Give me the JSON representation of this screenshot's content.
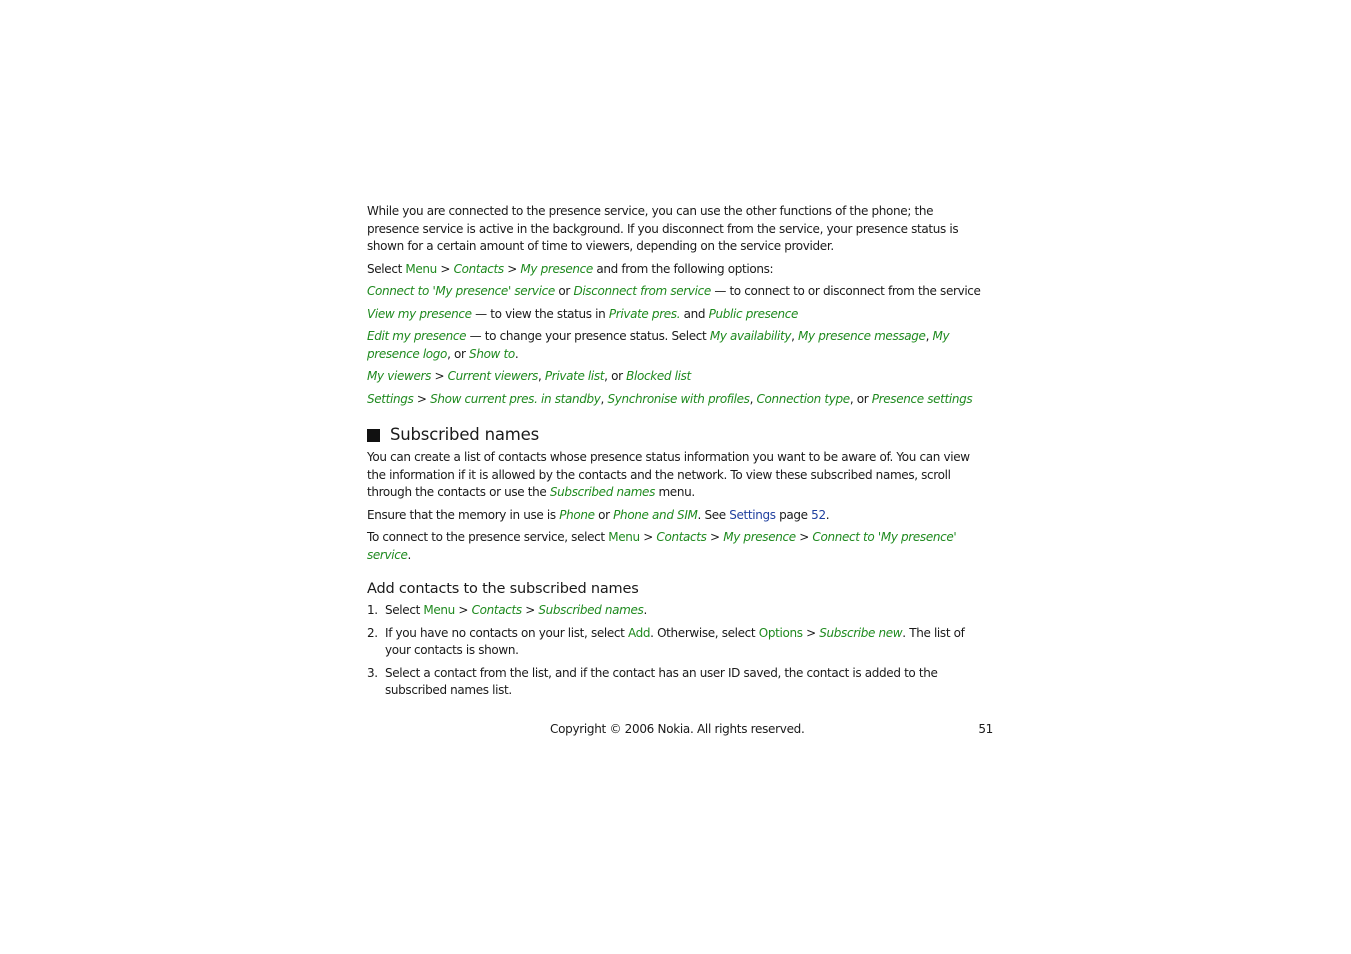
{
  "intro": {
    "p1": "While you are connected to the presence service, you can use the other functions of the phone; the presence service is active in the background. If you disconnect from the service, your presence status is shown for a certain amount of time to viewers, depending on the service provider.",
    "select_prefix": "Select ",
    "menu": "Menu",
    "sep": " > ",
    "contacts": "Contacts",
    "my_presence": "My presence",
    "select_suffix": " and from the following options:"
  },
  "options": {
    "connect": "Connect to 'My presence' service",
    "or": " or ",
    "disconnect": "Disconnect from service",
    "connect_desc": " — to connect to or disconnect from the service",
    "view": "View my presence",
    "view_desc": " — to view the status in ",
    "private_pres": "Private pres.",
    "and": " and ",
    "public_presence": "Public presence",
    "edit": "Edit my presence",
    "edit_desc": " — to change your presence status. Select ",
    "my_availability": "My availability",
    "comma": ", ",
    "my_presence_message": "My presence message",
    "my_presence_logo": "My presence logo",
    "or2": ", or ",
    "show_to": "Show to",
    "period": ".",
    "my_viewers": "My viewers",
    "current_viewers": "Current viewers",
    "private_list": "Private list",
    "blocked_list": "Blocked list",
    "settings": "Settings",
    "show_current": "Show current pres. in standby",
    "synchronise": "Synchronise with profiles",
    "connection_type": "Connection type",
    "presence_settings": "Presence settings"
  },
  "subscribed": {
    "heading": "Subscribed names",
    "p1_prefix": "You can create a list of contacts whose presence status information you want to be aware of. You can view the information if it is allowed by the contacts and the network. To view these subscribed names, scroll through the contacts or use the ",
    "subscribed_names": "Subscribed names",
    "p1_suffix": " menu.",
    "ensure_prefix": "Ensure that the memory in use is ",
    "phone": "Phone",
    "phone_and_sim": "Phone and SIM",
    "see": ". See ",
    "settings_link": "Settings",
    "page_word": " page ",
    "page_ref": "52",
    "connect_prefix": "To connect to the presence service, select ",
    "connect_service": "Connect to 'My presence' service"
  },
  "add_contacts": {
    "heading": "Add contacts to the subscribed names",
    "steps": [
      {
        "num": "1.",
        "pre": "Select ",
        "menu": "Menu",
        "contacts": "Contacts",
        "subscribed": "Subscribed names",
        "end": "."
      },
      {
        "num": "2.",
        "pre": "If you have no contacts on your list, select ",
        "add": "Add",
        "mid": ". Otherwise, select ",
        "options": "Options",
        "subscribe_new": "Subscribe new",
        "end": ". The list of your contacts is shown."
      },
      {
        "num": "3.",
        "text": "Select a contact from the list, and if the contact has an user ID saved, the contact is added to the subscribed names list."
      }
    ]
  },
  "footer": {
    "copyright": "Copyright © 2006 Nokia. All rights reserved.",
    "page_number": "51"
  },
  "colors": {
    "menu_green": "#1f8a1f",
    "link_blue": "#1f3f9f"
  }
}
